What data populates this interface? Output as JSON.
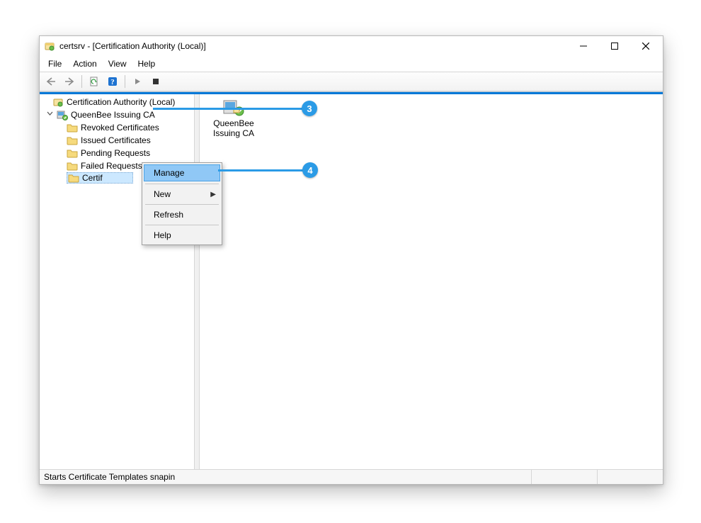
{
  "window": {
    "title": "certsrv - [Certification Authority (Local)]"
  },
  "menubar": {
    "file": "File",
    "action": "Action",
    "view": "View",
    "help": "Help"
  },
  "tree": {
    "root": "Certification Authority (Local)",
    "ca": "QueenBee Issuing CA",
    "items": {
      "revoked": "Revoked Certificates",
      "issued": "Issued Certificates",
      "pending": "Pending Requests",
      "failed": "Failed Requests",
      "templates_truncated": "Certif"
    }
  },
  "context_menu": {
    "manage": "Manage",
    "new": "New",
    "refresh": "Refresh",
    "help": "Help"
  },
  "list": {
    "ca_name_line1": "QueenBee",
    "ca_name_line2": "Issuing CA"
  },
  "statusbar": {
    "text": "Starts Certificate Templates snapin"
  },
  "annotations": {
    "a3": "3",
    "a4": "4"
  }
}
